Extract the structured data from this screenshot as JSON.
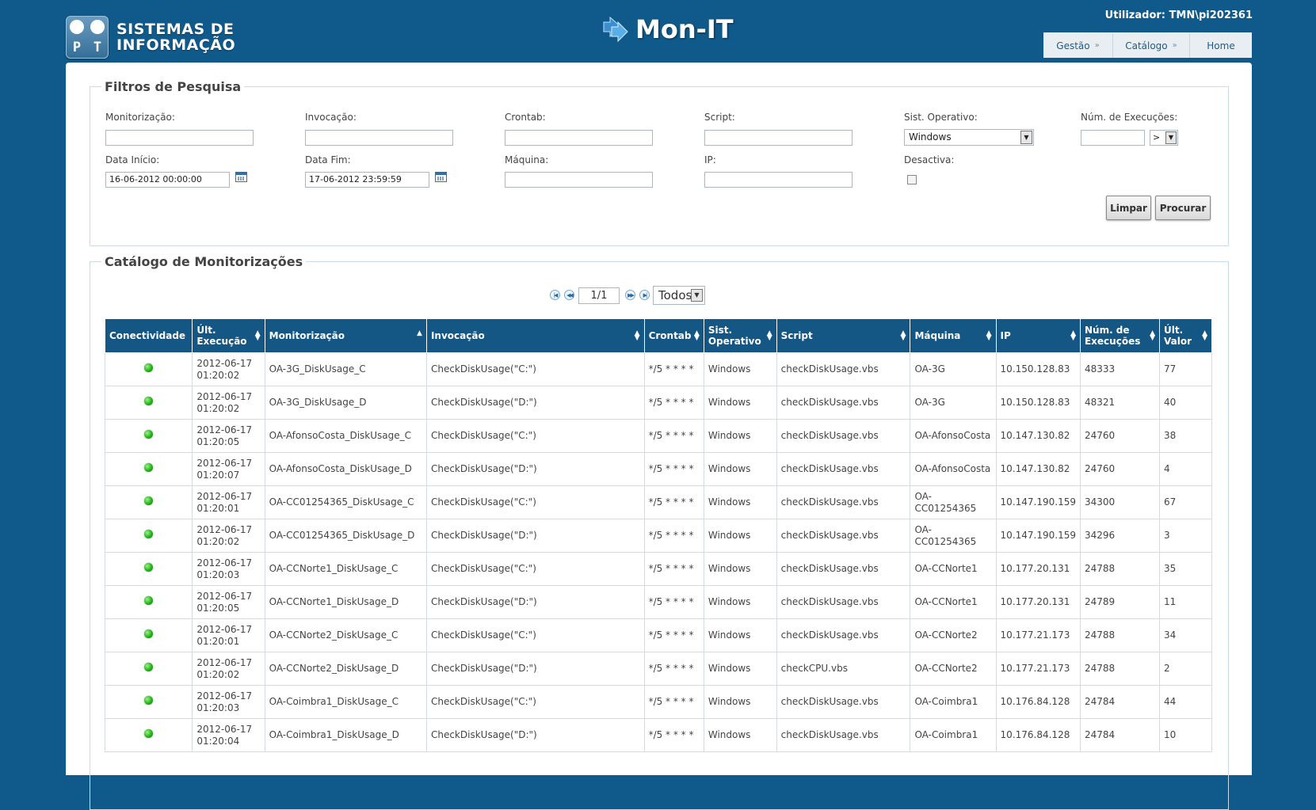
{
  "header": {
    "logo_line1": "SISTEMAS DE",
    "logo_line2": "INFORMAÇÃO",
    "logo_letters": [
      "P",
      "T"
    ],
    "app_title": "Mon-IT",
    "user_label": "Utilizador:",
    "user_name": "TMN\\pi202361",
    "nav": [
      {
        "label": "Gestão",
        "sep": "»"
      },
      {
        "label": "Catálogo",
        "sep": "»"
      },
      {
        "label": "Home",
        "sep": ""
      }
    ]
  },
  "filters": {
    "title": "Filtros de Pesquisa",
    "monitorizacao_label": "Monitorização:",
    "invocacao_label": "Invocação:",
    "crontab_label": "Crontab:",
    "script_label": "Script:",
    "so_label": "Sist. Operativo:",
    "so_value": "Windows",
    "num_exec_label": "Núm. de Execuções:",
    "num_exec_op": ">",
    "data_inicio_label": "Data Início:",
    "data_inicio_value": "16-06-2012 00:00:00",
    "data_fim_label": "Data Fim:",
    "data_fim_value": "17-06-2012 23:59:59",
    "maquina_label": "Máquina:",
    "ip_label": "IP:",
    "desactiva_label": "Desactiva:",
    "limpar": "Limpar",
    "procurar": "Procurar"
  },
  "catalog": {
    "title": "Catálogo de Monitorizações",
    "page_value": "1/1",
    "page_size": "Todos",
    "columns": [
      {
        "l1": "Conectividade",
        "l2": "",
        "sort": ""
      },
      {
        "l1": "Últ.",
        "l2": "Execução",
        "sort": "both"
      },
      {
        "l1": "Monitorização",
        "l2": "",
        "sort": "up"
      },
      {
        "l1": "Invocação",
        "l2": "",
        "sort": "both"
      },
      {
        "l1": "Crontab",
        "l2": "",
        "sort": "both"
      },
      {
        "l1": "Sist.",
        "l2": "Operativo",
        "sort": "both"
      },
      {
        "l1": "Script",
        "l2": "",
        "sort": "both"
      },
      {
        "l1": "Máquina",
        "l2": "",
        "sort": "both"
      },
      {
        "l1": "IP",
        "l2": "",
        "sort": "both"
      },
      {
        "l1": "Núm. de",
        "l2": "Execuções",
        "sort": "both"
      },
      {
        "l1": "Últ.",
        "l2": "Valor",
        "sort": "both"
      }
    ],
    "rows": [
      {
        "status": "ok",
        "date": "2012-06-17",
        "time": "01:20:02",
        "mon": "OA-3G_DiskUsage_C",
        "inv": "CheckDiskUsage(\"C:\")",
        "cron": "*/5 * * * *",
        "so": "Windows",
        "script": "checkDiskUsage.vbs",
        "maq": "OA-3G",
        "ip": "10.150.128.83",
        "exec": "48333",
        "val": "77"
      },
      {
        "status": "ok",
        "date": "2012-06-17",
        "time": "01:20:02",
        "mon": "OA-3G_DiskUsage_D",
        "inv": "CheckDiskUsage(\"D:\")",
        "cron": "*/5 * * * *",
        "so": "Windows",
        "script": "checkDiskUsage.vbs",
        "maq": "OA-3G",
        "ip": "10.150.128.83",
        "exec": "48321",
        "val": "40"
      },
      {
        "status": "ok",
        "date": "2012-06-17",
        "time": "01:20:05",
        "mon": "OA-AfonsoCosta_DiskUsage_C",
        "inv": "CheckDiskUsage(\"C:\")",
        "cron": "*/5 * * * *",
        "so": "Windows",
        "script": "checkDiskUsage.vbs",
        "maq": "OA-AfonsoCosta",
        "ip": "10.147.130.82",
        "exec": "24760",
        "val": "38"
      },
      {
        "status": "ok",
        "date": "2012-06-17",
        "time": "01:20:07",
        "mon": "OA-AfonsoCosta_DiskUsage_D",
        "inv": "CheckDiskUsage(\"D:\")",
        "cron": "*/5 * * * *",
        "so": "Windows",
        "script": "checkDiskUsage.vbs",
        "maq": "OA-AfonsoCosta",
        "ip": "10.147.130.82",
        "exec": "24760",
        "val": "4"
      },
      {
        "status": "ok",
        "date": "2012-06-17",
        "time": "01:20:01",
        "mon": "OA-CC01254365_DiskUsage_C",
        "inv": "CheckDiskUsage(\"C:\")",
        "cron": "*/5 * * * *",
        "so": "Windows",
        "script": "checkDiskUsage.vbs",
        "maq": "OA-CC01254365",
        "ip": "10.147.190.159",
        "exec": "34300",
        "val": "67"
      },
      {
        "status": "ok",
        "date": "2012-06-17",
        "time": "01:20:02",
        "mon": "OA-CC01254365_DiskUsage_D",
        "inv": "CheckDiskUsage(\"D:\")",
        "cron": "*/5 * * * *",
        "so": "Windows",
        "script": "checkDiskUsage.vbs",
        "maq": "OA-CC01254365",
        "ip": "10.147.190.159",
        "exec": "34296",
        "val": "3"
      },
      {
        "status": "ok",
        "date": "2012-06-17",
        "time": "01:20:03",
        "mon": "OA-CCNorte1_DiskUsage_C",
        "inv": "CheckDiskUsage(\"C:\")",
        "cron": "*/5 * * * *",
        "so": "Windows",
        "script": "checkDiskUsage.vbs",
        "maq": "OA-CCNorte1",
        "ip": "10.177.20.131",
        "exec": "24788",
        "val": "35"
      },
      {
        "status": "ok",
        "date": "2012-06-17",
        "time": "01:20:05",
        "mon": "OA-CCNorte1_DiskUsage_D",
        "inv": "CheckDiskUsage(\"D:\")",
        "cron": "*/5 * * * *",
        "so": "Windows",
        "script": "checkDiskUsage.vbs",
        "maq": "OA-CCNorte1",
        "ip": "10.177.20.131",
        "exec": "24789",
        "val": "11"
      },
      {
        "status": "ok",
        "date": "2012-06-17",
        "time": "01:20:01",
        "mon": "OA-CCNorte2_DiskUsage_C",
        "inv": "CheckDiskUsage(\"C:\")",
        "cron": "*/5 * * * *",
        "so": "Windows",
        "script": "checkDiskUsage.vbs",
        "maq": "OA-CCNorte2",
        "ip": "10.177.21.173",
        "exec": "24788",
        "val": "34"
      },
      {
        "status": "ok",
        "date": "2012-06-17",
        "time": "01:20:02",
        "mon": "OA-CCNorte2_DiskUsage_D",
        "inv": "CheckDiskUsage(\"D:\")",
        "cron": "*/5 * * * *",
        "so": "Windows",
        "script": "checkCPU.vbs",
        "maq": "OA-CCNorte2",
        "ip": "10.177.21.173",
        "exec": "24788",
        "val": "2"
      },
      {
        "status": "ok",
        "date": "2012-06-17",
        "time": "01:20:03",
        "mon": "OA-Coimbra1_DiskUsage_C",
        "inv": "CheckDiskUsage(\"C:\")",
        "cron": "*/5 * * * *",
        "so": "Windows",
        "script": "checkDiskUsage.vbs",
        "maq": "OA-Coimbra1",
        "ip": "10.176.84.128",
        "exec": "24784",
        "val": "44"
      },
      {
        "status": "ok",
        "date": "2012-06-17",
        "time": "01:20:04",
        "mon": "OA-Coimbra1_DiskUsage_D",
        "inv": "CheckDiskUsage(\"D:\")",
        "cron": "*/5 * * * *",
        "so": "Windows",
        "script": "checkDiskUsage.vbs",
        "maq": "OA-Coimbra1",
        "ip": "10.176.84.128",
        "exec": "24784",
        "val": "10"
      }
    ]
  },
  "icons": {
    "status_ok": "green-dot-icon",
    "calendar": "calendar-icon",
    "first": "first-page-icon",
    "prev": "prev-page-icon",
    "next": "next-page-icon",
    "last": "last-page-icon",
    "app": "arrow-logo-icon"
  },
  "colors": {
    "background": "#0f5a8a",
    "header_row": "#145785",
    "status_ok": "#22b318"
  }
}
